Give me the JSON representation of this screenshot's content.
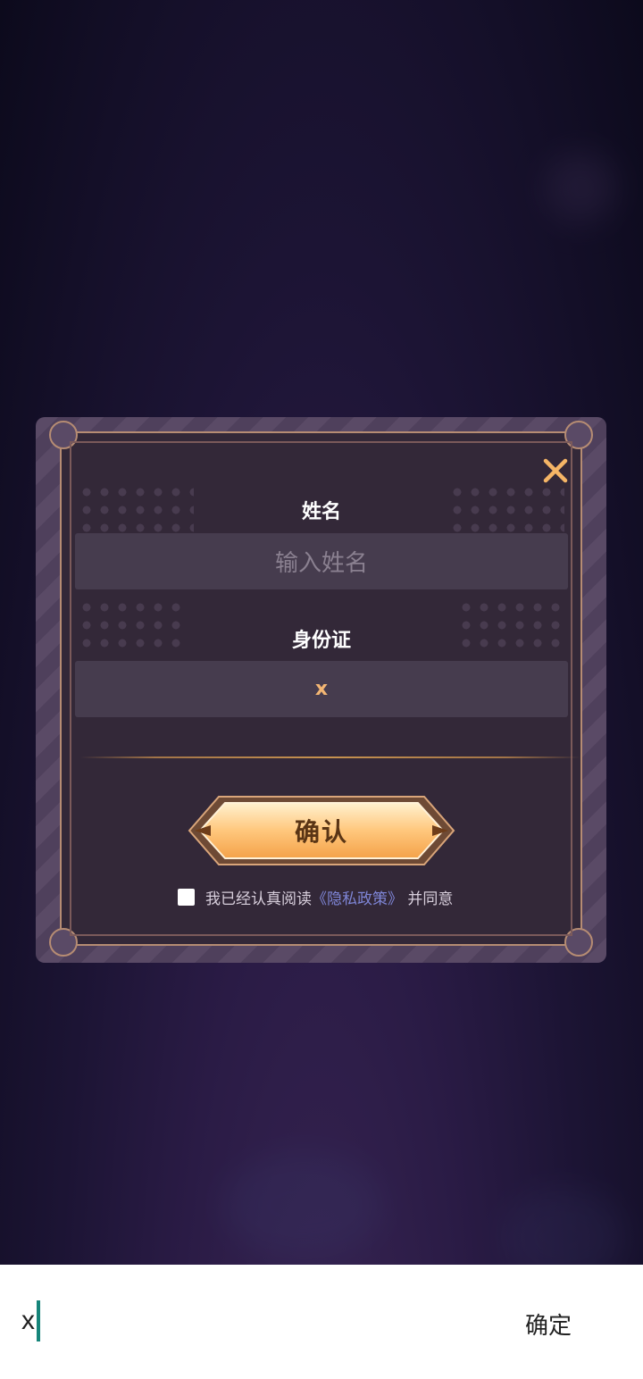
{
  "dialog": {
    "name_label": "姓名",
    "name_placeholder": "输入姓名",
    "name_value": "",
    "id_label": "身份证",
    "id_value": "x",
    "confirm_label": "确认",
    "agree_prefix": "我已经认真阅读",
    "policy_link": "《隐私政策》",
    "agree_suffix": "并同意",
    "close_icon": "close-icon"
  },
  "keyboard_bar": {
    "input_text": "x",
    "confirm_label": "确定"
  },
  "colors": {
    "accent": "#f5b566",
    "link": "#7e85d6",
    "caret": "#16857a"
  }
}
